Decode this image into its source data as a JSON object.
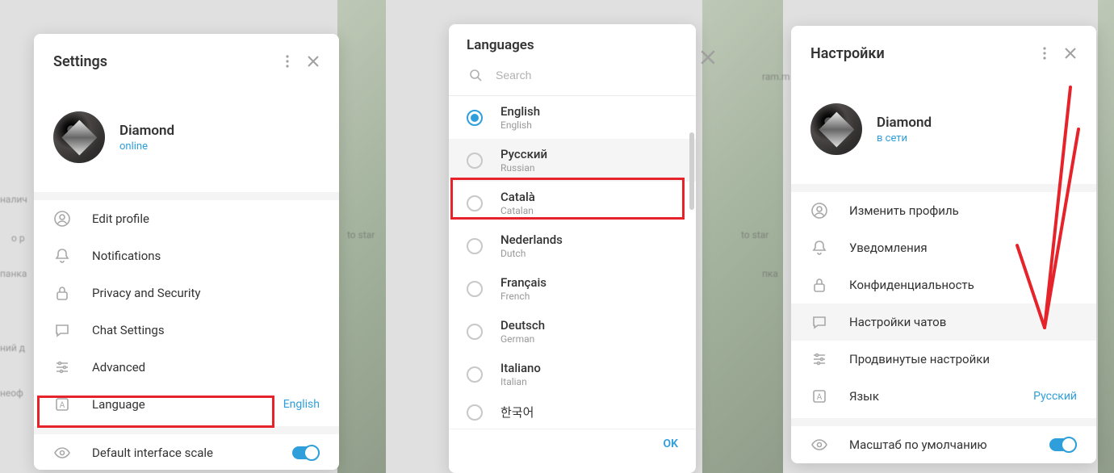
{
  "panel1": {
    "title": "Settings",
    "profile": {
      "name": "Diamond",
      "status": "online"
    },
    "menu": [
      {
        "id": "edit-profile",
        "label": "Edit profile",
        "icon": "user"
      },
      {
        "id": "notifications",
        "label": "Notifications",
        "icon": "bell"
      },
      {
        "id": "privacy",
        "label": "Privacy and Security",
        "icon": "lock"
      },
      {
        "id": "chat-settings",
        "label": "Chat Settings",
        "icon": "chat"
      },
      {
        "id": "advanced",
        "label": "Advanced",
        "icon": "sliders"
      },
      {
        "id": "language",
        "label": "Language",
        "icon": "lang-a",
        "value": "English"
      }
    ],
    "scale_row": {
      "label": "Default interface scale",
      "icon": "eye",
      "toggle": true
    }
  },
  "panel2": {
    "title": "Languages",
    "search_placeholder": "Search",
    "languages": [
      {
        "name": "English",
        "native": "English",
        "selected": true
      },
      {
        "name": "Русский",
        "native": "Russian",
        "selected": false,
        "highlighted": true
      },
      {
        "name": "Català",
        "native": "Catalan",
        "selected": false
      },
      {
        "name": "Nederlands",
        "native": "Dutch",
        "selected": false
      },
      {
        "name": "Français",
        "native": "French",
        "selected": false
      },
      {
        "name": "Deutsch",
        "native": "German",
        "selected": false
      },
      {
        "name": "Italiano",
        "native": "Italian",
        "selected": false
      },
      {
        "name": "한국어",
        "native": "",
        "selected": false
      }
    ],
    "ok_label": "OK"
  },
  "panel3": {
    "title": "Настройки",
    "profile": {
      "name": "Diamond",
      "status": "в сети"
    },
    "menu": [
      {
        "id": "edit-profile",
        "label": "Изменить профиль",
        "icon": "user"
      },
      {
        "id": "notifications",
        "label": "Уведомления",
        "icon": "bell"
      },
      {
        "id": "privacy",
        "label": "Конфиденциальность",
        "icon": "lock"
      },
      {
        "id": "chat-settings",
        "label": "Настройки чатов",
        "icon": "chat",
        "highlighted": true
      },
      {
        "id": "advanced",
        "label": "Продвинутые настройки",
        "icon": "sliders"
      },
      {
        "id": "language",
        "label": "Язык",
        "icon": "lang-a",
        "value": "Русский"
      }
    ],
    "scale_row": {
      "label": "Масштаб по умолчанию",
      "icon": "eye",
      "toggle": true
    }
  },
  "bg_text": {
    "to_star": "to star",
    "panka": "панка",
    "papka": "пка",
    "op": "о р",
    "ram": "ram.m",
    "nalich": "налич",
    "neoph": "неоф",
    "nij": "ний д"
  }
}
